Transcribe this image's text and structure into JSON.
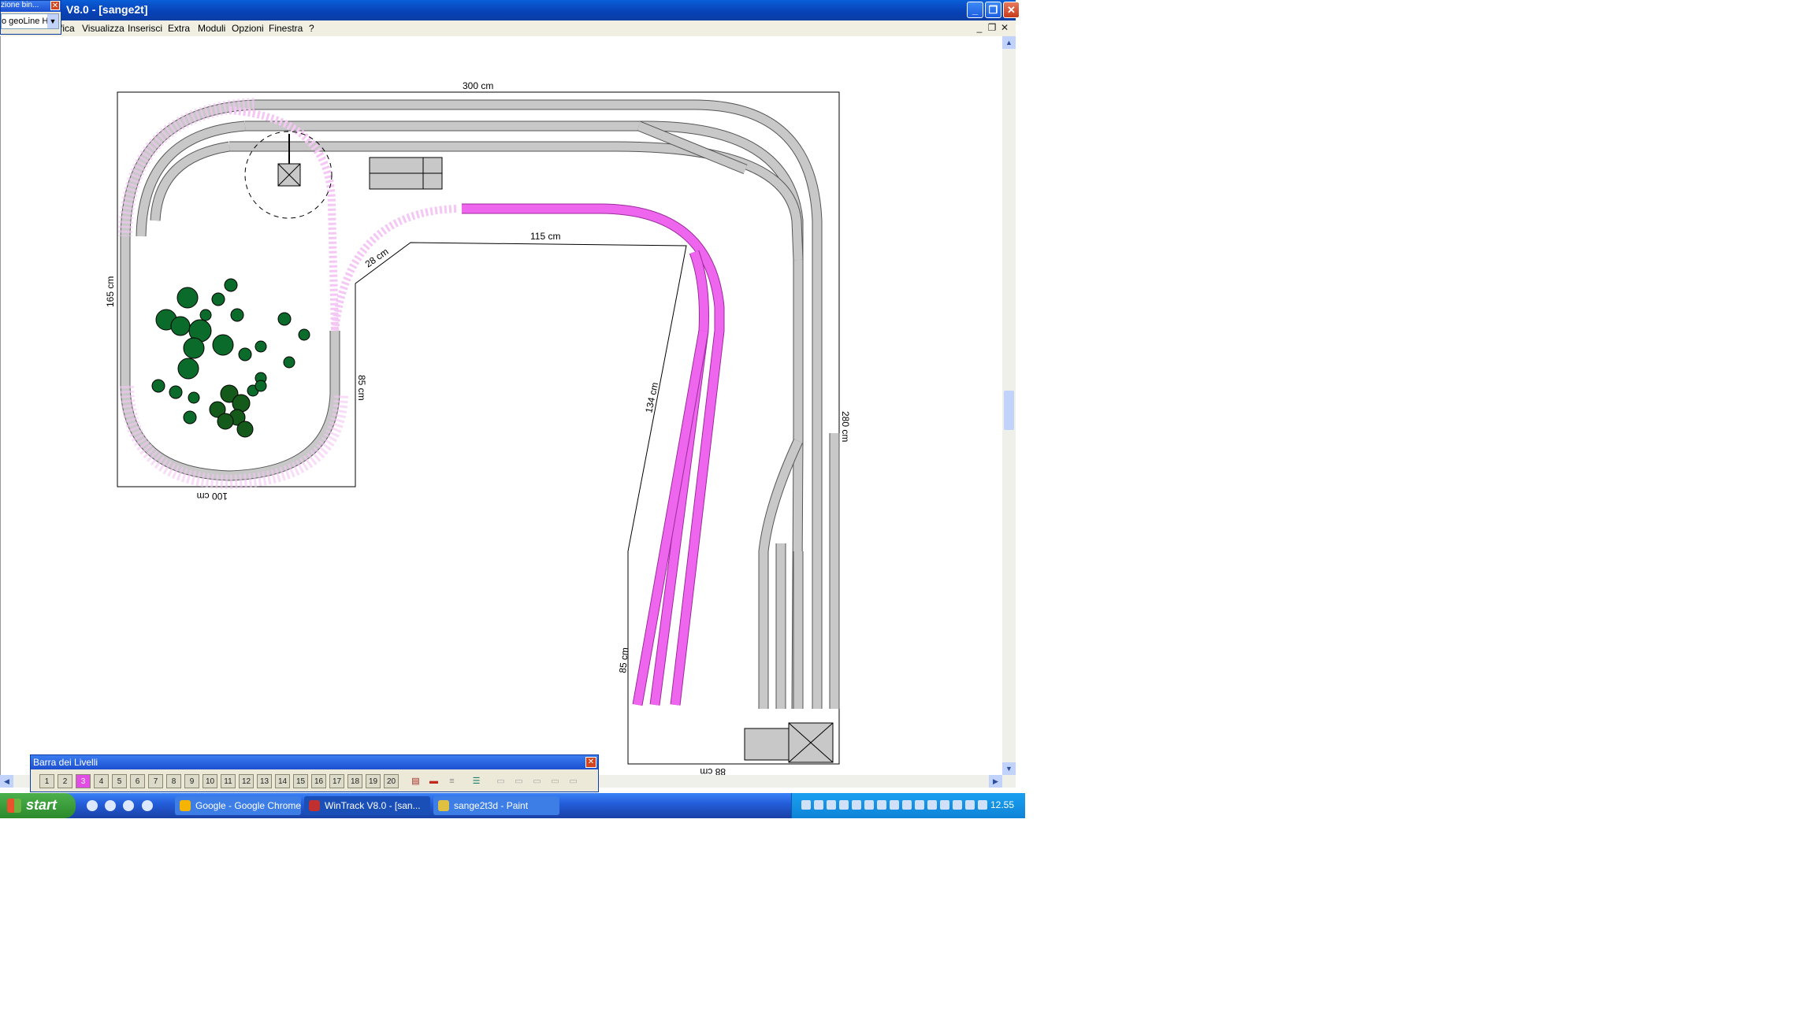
{
  "window": {
    "title": "V8.0 - [sange2t]",
    "title_prefix_glyph": "‹",
    "minimize": "_",
    "restore": "❐",
    "close": "✕"
  },
  "menu": {
    "items": [
      "fica",
      "Visualizza",
      "Inserisci",
      "Extra",
      "Moduli",
      "Opzioni",
      "Finestra",
      "?"
    ],
    "mdi_min": "_",
    "mdi_restore": "❐",
    "mdi_close": "✕"
  },
  "floating_window": {
    "title": "zione bin...",
    "select_value": "o geoLine H",
    "close": "✕"
  },
  "layout_dimensions": {
    "top": "300 cm",
    "inner_top": "115 cm",
    "diag_small": "28 cm",
    "left": "165 cm",
    "inner_left": "85 cm",
    "bottom_left": "100 cm",
    "diagonal": "134 cm",
    "lower_diag": "85 cm",
    "right": "280 cm",
    "bottom_right": "88 cm"
  },
  "levels_bar": {
    "title": "Barra dei Livelli",
    "levels": [
      "1",
      "2",
      "3",
      "4",
      "5",
      "6",
      "7",
      "8",
      "9",
      "10",
      "11",
      "12",
      "13",
      "14",
      "15",
      "16",
      "17",
      "18",
      "19",
      "20"
    ],
    "active_level": "3",
    "close": "✕"
  },
  "taskbar": {
    "start": "start",
    "tasks": [
      {
        "label": "Google - Google Chrome",
        "color": "#3c7de6"
      },
      {
        "label": "WinTrack  V8.0 - [san...",
        "color": "#1b4fb8"
      },
      {
        "label": "sange2t3d - Paint",
        "color": "#3c7de6"
      }
    ],
    "clock": "12.55"
  },
  "colors": {
    "track_gray": "#c8c8c8",
    "track_edge": "#555555",
    "track_selected": "#ee66ee",
    "tree_green": "#0b6b2a",
    "titlebar_blue": "#0842b8",
    "taskbar_blue": "#245edb",
    "start_green": "#3a9e3a"
  }
}
